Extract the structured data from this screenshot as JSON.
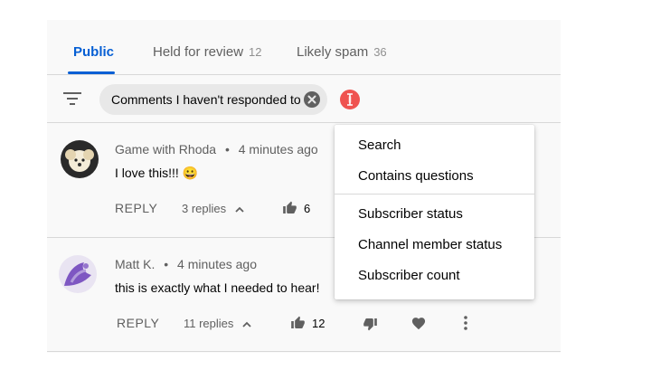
{
  "tabs": [
    {
      "label": "Public",
      "count": ""
    },
    {
      "label": "Held for review",
      "count": "12"
    },
    {
      "label": "Likely spam",
      "count": "36"
    }
  ],
  "filter": {
    "chip_label": "Comments I haven't responded to"
  },
  "comments": [
    {
      "author": "Game with Rhoda",
      "time": "4 minutes ago",
      "text": "I love this!!! 😀",
      "reply_label": "REPLY",
      "replies": "3 replies",
      "likes": "6"
    },
    {
      "author": "Matt K.",
      "time": "4 minutes ago",
      "text": "this is exactly what I needed to hear!",
      "reply_label": "REPLY",
      "replies": "11 replies",
      "likes": "12"
    }
  ],
  "menu": {
    "group1": [
      "Search",
      "Contains questions"
    ],
    "group2": [
      "Subscriber status",
      "Channel member status",
      "Subscriber count"
    ]
  },
  "colors": {
    "accent": "#065fd4",
    "alert": "#ef5350",
    "chip": "#e8e8e8"
  }
}
